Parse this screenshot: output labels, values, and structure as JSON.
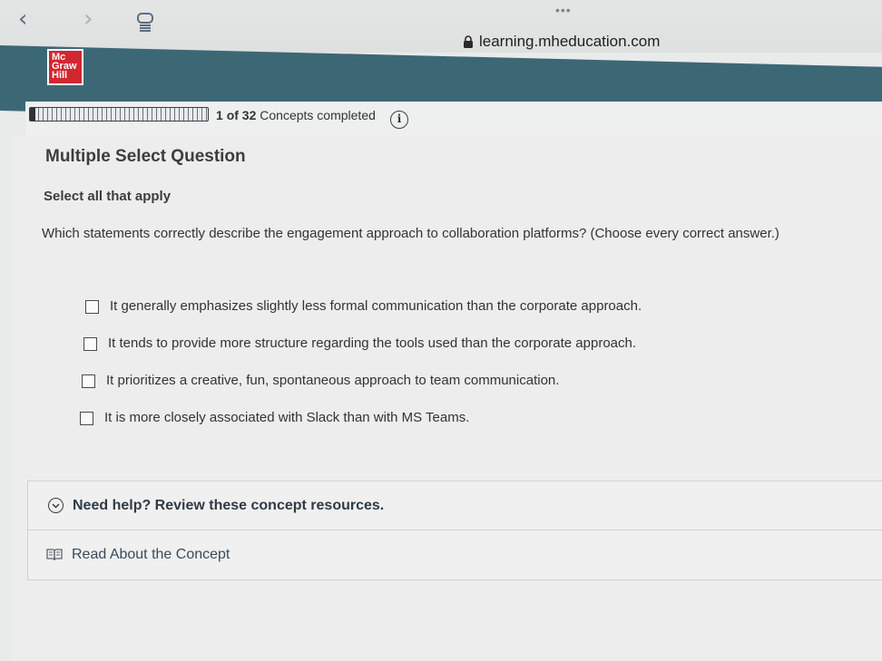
{
  "browser": {
    "url": "learning.mheducation.com"
  },
  "brand": {
    "logo_lines": [
      "Mc",
      "Graw",
      "Hill"
    ],
    "logo_color": "#d22730",
    "header_color": "#3c6876"
  },
  "progress": {
    "completed": "1",
    "of_label": "of",
    "total": "32",
    "suffix": "Concepts completed",
    "fraction": 0.03125
  },
  "question": {
    "type": "Multiple Select Question",
    "instruction": "Select all that apply",
    "prompt": "Which statements correctly describe the engagement approach to collaboration platforms? (Choose every correct answer.)",
    "options": [
      {
        "label": "It generally emphasizes slightly less formal communication than the corporate approach.",
        "checked": false
      },
      {
        "label": "It tends to provide more structure regarding the tools used than the corporate approach.",
        "checked": false
      },
      {
        "label": "It prioritizes a creative, fun, spontaneous approach to team communication.",
        "checked": false
      },
      {
        "label": "It is more closely associated with Slack than with MS Teams.",
        "checked": false
      }
    ]
  },
  "help": {
    "title": "Need help? Review these concept resources.",
    "resource_label": "Read About the Concept"
  }
}
